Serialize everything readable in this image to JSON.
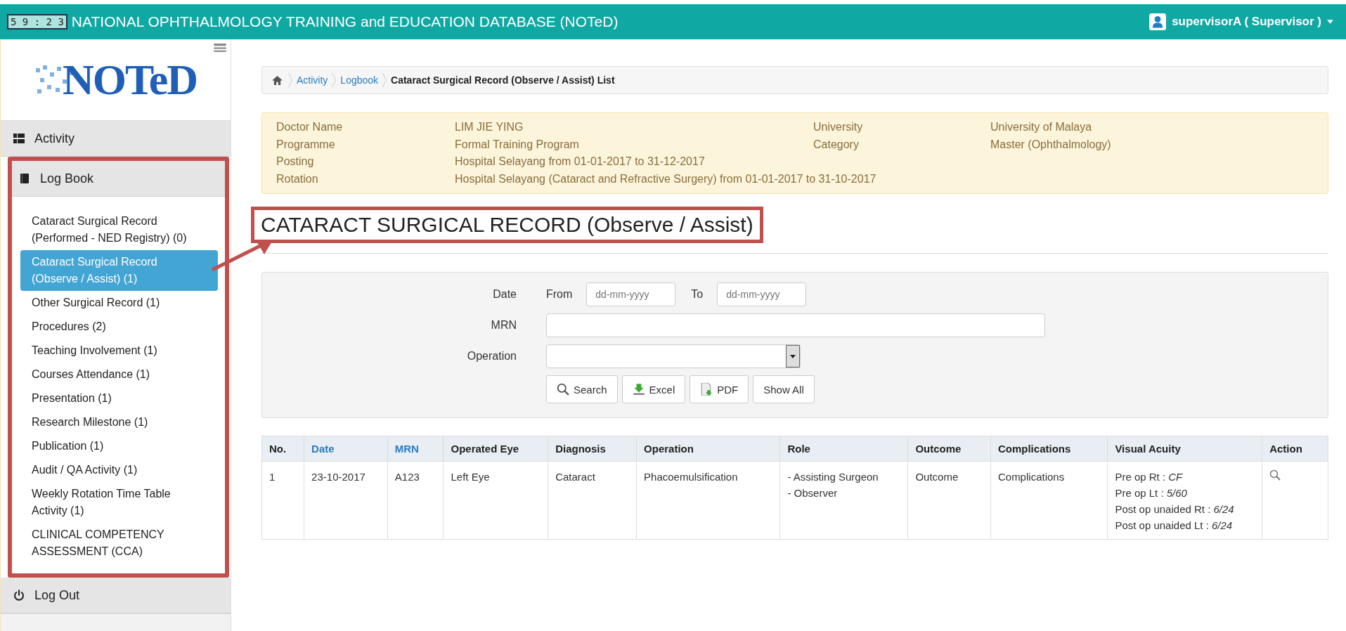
{
  "top_bar": {
    "timer": "5 9 : 2 3",
    "title": "NATIONAL OPHTHALMOLOGY TRAINING and EDUCATION DATABASE (NOTeD)",
    "user": "supervisorA ( Supervisor )"
  },
  "sidebar": {
    "logo": "NOTeD",
    "sections": [
      {
        "kind": "activity",
        "label": "Activity",
        "highlighted": false
      },
      {
        "kind": "book",
        "label": "Log Book",
        "highlighted": true,
        "items": [
          {
            "label": "Cataract Surgical Record (Performed - NED Registry) (0)",
            "selected": false
          },
          {
            "label": "Cataract Surgical Record (Observe / Assist) (1)",
            "selected": true
          },
          {
            "label": "Other Surgical Record (1)",
            "selected": false
          },
          {
            "label": "Procedures (2)",
            "selected": false
          },
          {
            "label": "Teaching Involvement (1)",
            "selected": false
          },
          {
            "label": "Courses Attendance (1)",
            "selected": false
          },
          {
            "label": "Presentation (1)",
            "selected": false
          },
          {
            "label": "Research Milestone (1)",
            "selected": false
          },
          {
            "label": "Publication (1)",
            "selected": false
          },
          {
            "label": "Audit / QA Activity (1)",
            "selected": false
          },
          {
            "label": "Weekly Rotation Time Table Activity (1)",
            "selected": false
          },
          {
            "label": "CLINICAL COMPETENCY ASSESSMENT (CCA)",
            "selected": false
          }
        ]
      },
      {
        "kind": "power",
        "label": "Log Out",
        "highlighted": false
      }
    ]
  },
  "breadcrumb": [
    {
      "label": "Activity",
      "link": true
    },
    {
      "label": "Logbook",
      "link": true
    },
    {
      "label": "Cataract Surgical Record (Observe / Assist) List",
      "link": false
    }
  ],
  "info": [
    {
      "label": "Doctor Name",
      "value": "LIM JIE YING",
      "label_2": "University",
      "value_2": "University of Malaya"
    },
    {
      "label": "Programme",
      "value": "Formal Training Program",
      "label_2": "Category",
      "value_2": "Master (Ophthalmology)"
    },
    {
      "label": "Posting",
      "value": "Hospital Selayang from 01-01-2017 to 31-12-2017"
    },
    {
      "label": "Rotation",
      "value": "Hospital Selayang (Cataract and Refractive Surgery) from 01-01-2017 to 31-10-2017"
    }
  ],
  "heading": "CATARACT SURGICAL RECORD (Observe / Assist)",
  "filter": {
    "date_label": "Date",
    "from_label": "From",
    "from_placeholder": "dd-mm-yyyy",
    "to_label": "To",
    "to_placeholder": "dd-mm-yyyy",
    "mrn_label": "MRN",
    "operation_label": "Operation",
    "buttons": [
      {
        "kind": "search",
        "label": "Search"
      },
      {
        "kind": "excel",
        "label": "Excel"
      },
      {
        "kind": "pdf",
        "label": "PDF"
      },
      {
        "kind": "plain",
        "label": "Show All"
      }
    ]
  },
  "table": {
    "columns": [
      {
        "label": "No.",
        "sortable": false
      },
      {
        "label": "Date",
        "sortable": true
      },
      {
        "label": "MRN",
        "sortable": true
      },
      {
        "label": "Operated Eye",
        "sortable": false
      },
      {
        "label": "Diagnosis",
        "sortable": false
      },
      {
        "label": "Operation",
        "sortable": false
      },
      {
        "label": "Role",
        "sortable": false
      },
      {
        "label": "Outcome",
        "sortable": false
      },
      {
        "label": "Complications",
        "sortable": false
      },
      {
        "label": "Visual Acuity",
        "sortable": false
      },
      {
        "label": "Action",
        "sortable": false
      }
    ],
    "rows": [
      {
        "no": "1",
        "date": "23-10-2017",
        "mrn": "A123",
        "eye": "Left Eye",
        "diagnosis": "Cataract",
        "operation": "Phacoemulsification",
        "roles": [
          "- Assisting Surgeon",
          "- Observer"
        ],
        "outcome": "Outcome",
        "complications": "Complications",
        "visual_acuity": [
          "Pre op Rt : *CF*",
          "Pre op Lt : *5/60*",
          "Post op unaided Rt : *6/24*",
          "Post op unaided Lt : *6/24*"
        ]
      }
    ]
  }
}
